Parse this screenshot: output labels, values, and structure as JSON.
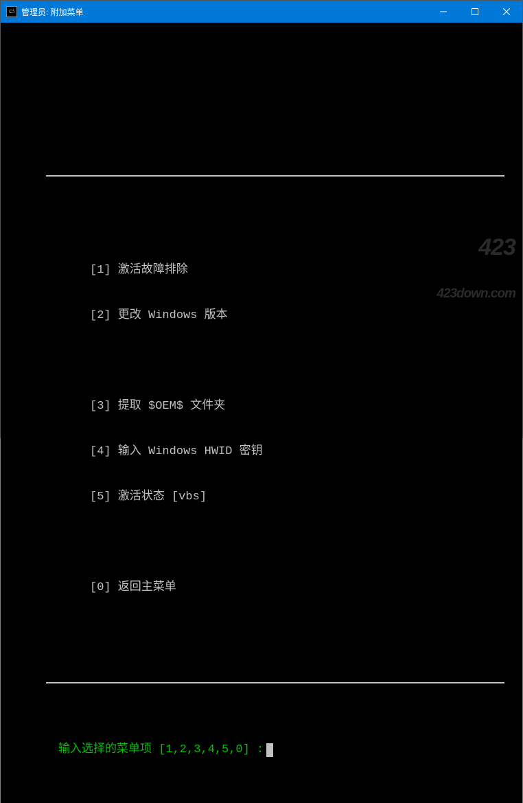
{
  "window": {
    "icon_text": "C:\\",
    "title": "管理员:  附加菜单"
  },
  "menu": {
    "group1": [
      "[1] 激活故障排除",
      "[2] 更改 Windows 版本"
    ],
    "group2": [
      "[3] 提取 $OEM$ 文件夹",
      "[4] 输入 Windows HWID 密钥",
      "[5] 激活状态 [vbs]"
    ],
    "group3": [
      "[0] 返回主菜单"
    ]
  },
  "prompt": "输入选择的菜单项 [1,2,3,4,5,0] :",
  "watermark": {
    "line1": "423",
    "line2": "423down.com"
  }
}
